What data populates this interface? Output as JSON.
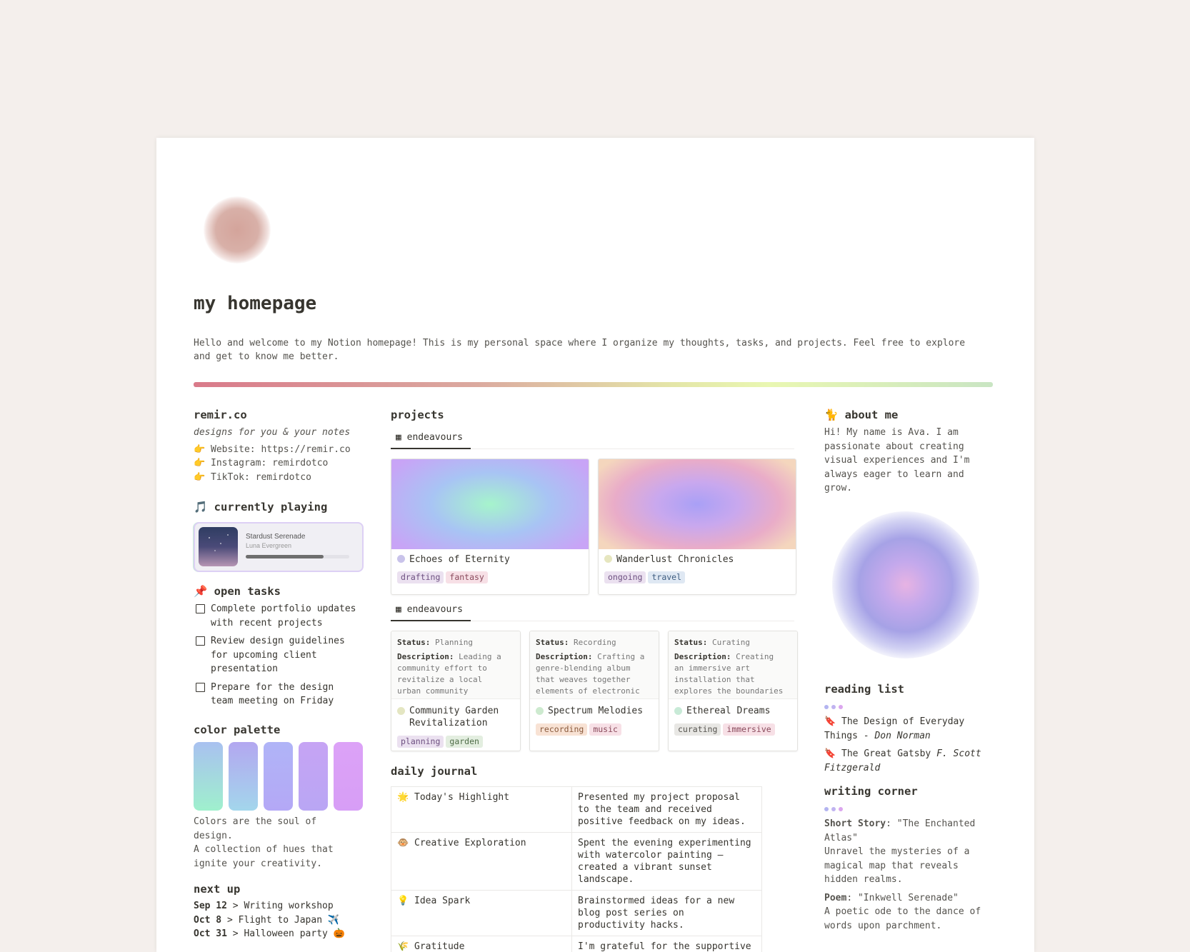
{
  "page": {
    "title": "my homepage",
    "intro": "Hello and welcome to my Notion homepage! This is my personal space where I organize my thoughts, tasks, and projects. Feel free to explore and get to know me better."
  },
  "left": {
    "brand": {
      "title": "remir.co",
      "tagline": "designs for you & your notes",
      "links": [
        {
          "icon": "👉",
          "text": "Website: https://remir.co"
        },
        {
          "icon": "👉",
          "text": "Instagram: remirdotco"
        },
        {
          "icon": "👉",
          "text": "TikTok: remirdotco"
        }
      ]
    },
    "now_playing": {
      "icon": "🎵",
      "title": "currently playing",
      "song": "Stardust Serenade",
      "artist": "Luna Evergreen",
      "progress": 0.75
    },
    "tasks": {
      "icon": "📌",
      "title": "open tasks",
      "items": [
        {
          "lines": [
            "Complete portfolio updates",
            "with recent projects"
          ],
          "done": false
        },
        {
          "lines": [
            "Review design guidelines",
            "for upcoming client",
            "presentation"
          ],
          "done": false
        },
        {
          "lines": [
            "Prepare for the design",
            "team meeting on Friday"
          ],
          "done": false
        }
      ]
    },
    "palette": {
      "title": "color palette",
      "colors": [
        [
          "#a9c1f0",
          "#9ff0cd"
        ],
        [
          "#b3a7f0",
          "#a3d6ec"
        ],
        [
          "#b0b4f7",
          "#b4a8f6"
        ],
        [
          "#c6a4f4",
          "#b9a6f4"
        ],
        [
          "#dca2f7",
          "#d79ef6"
        ]
      ],
      "caption_lines": [
        "Colors are the soul of",
        "design.",
        "A collection of hues that",
        "ignite your creativity."
      ]
    },
    "next_up": {
      "title": "next up",
      "items": [
        {
          "date": "Sep 12",
          "text": " > Writing workshop"
        },
        {
          "date": "Oct 8",
          "text": " > Flight to Japan ✈️"
        },
        {
          "date": "Oct 31",
          "text": " > Halloween party 🎃"
        }
      ]
    }
  },
  "projects": {
    "title": "projects",
    "tab_top": "endeavours",
    "tab_bottom": "endeavours",
    "gallery": [
      {
        "name": "Echoes of Eternity",
        "dot": "#c9c3ea",
        "tags": [
          {
            "text": "drafting",
            "bg": "#ebe1f0",
            "fg": "#6d4f80"
          },
          {
            "text": "fantasy",
            "bg": "#f7e0e6",
            "fg": "#8a4a5c"
          }
        ]
      },
      {
        "name": "Wanderlust Chronicles",
        "dot": "#e6e6bf",
        "tags": [
          {
            "text": "ongoing",
            "bg": "#ebe1f0",
            "fg": "#6d4f80"
          },
          {
            "text": "travel",
            "bg": "#dfe8f3",
            "fg": "#3f5d80"
          }
        ]
      }
    ],
    "board": [
      {
        "status_label": "Status:",
        "status": "Planning",
        "desc_label": "Description:",
        "desc_lines": [
          "Leading a",
          "community effort to",
          "revitalize a local",
          "urban community"
        ],
        "name_lines": [
          "Community Garden",
          "Revitalization"
        ],
        "dot": "#e4e6c2",
        "tags": [
          {
            "text": "planning",
            "bg": "#ebe1f0",
            "fg": "#6d4f80"
          },
          {
            "text": "garden",
            "bg": "#e3eee0",
            "fg": "#4f6d48"
          }
        ]
      },
      {
        "status_label": "Status:",
        "status": "Recording",
        "desc_label": "Description:",
        "desc_lines": [
          "Crafting a",
          "genre-blending album",
          "that weaves together",
          "elements of electronic"
        ],
        "name_lines": [
          "Spectrum Melodies"
        ],
        "dot": "#cdeacf",
        "tags": [
          {
            "text": "recording",
            "bg": "#f8e2d4",
            "fg": "#8a5a3c"
          },
          {
            "text": "music",
            "bg": "#f7e0e6",
            "fg": "#8a4a5c"
          }
        ]
      },
      {
        "status_label": "Status:",
        "status": "Curating",
        "desc_label": "Description:",
        "desc_lines": [
          "Creating",
          "an immersive art",
          "installation that",
          "explores the boundaries"
        ],
        "name_lines": [
          "Ethereal Dreams"
        ],
        "dot": "#c8ead7",
        "tags": [
          {
            "text": "curating",
            "bg": "#e8e7e4",
            "fg": "#55534e"
          },
          {
            "text": "immersive",
            "bg": "#f7e0e6",
            "fg": "#8a4a5c"
          }
        ]
      }
    ]
  },
  "journal": {
    "title": "daily journal",
    "rows": [
      {
        "icon": "🌟",
        "label": "Today's Highlight",
        "lines": [
          "Presented my project proposal",
          "to the team and received",
          "positive feedback on my ideas."
        ]
      },
      {
        "icon": "🐵",
        "label": "Creative Exploration",
        "lines": [
          "Spent the evening experimenting",
          "with watercolor painting –",
          "created a vibrant sunset",
          "landscape."
        ]
      },
      {
        "icon": "💡",
        "label": "Idea Spark",
        "lines": [
          "Brainstormed ideas for a new",
          "blog post series on",
          "productivity hacks."
        ]
      },
      {
        "icon": "🌾",
        "label": "Gratitude",
        "lines": [
          "I'm grateful for the supportive"
        ]
      }
    ]
  },
  "right": {
    "about": {
      "icon": "🐈",
      "title": "about me",
      "lines": [
        "Hi! My name is Ava. I am",
        "passionate about creating",
        "visual experiences and I'm",
        "always eager to learn and",
        "grow."
      ]
    },
    "reading": {
      "title": "reading list",
      "dots": [
        "#b3b4f0",
        "#c0b3f0",
        "#dba6ee"
      ],
      "books": [
        {
          "icon": "🔖",
          "title": "The Design of Everyday",
          "title2": "Things - ",
          "author": "Don Norman"
        },
        {
          "icon": "🔖",
          "title": "The Great Gatsby ",
          "title2": "",
          "author": "F. Scott",
          "author2": "Fitzgerald"
        }
      ]
    },
    "writing": {
      "title": "writing corner",
      "dots": [
        "#b3b4f0",
        "#c0b3f0",
        "#dba6ee"
      ],
      "story_label": "Short Story",
      "story_title": ": \"The Enchanted",
      "story_title2": "Atlas\"",
      "story_lines": [
        "Unravel the mysteries of a",
        "magical map that reveals",
        "hidden realms."
      ],
      "poem_label": "Poem",
      "poem_title": ": \"Inkwell Serenade\"",
      "poem_lines": [
        "A poetic ode to the dance of",
        "words upon parchment."
      ]
    }
  }
}
